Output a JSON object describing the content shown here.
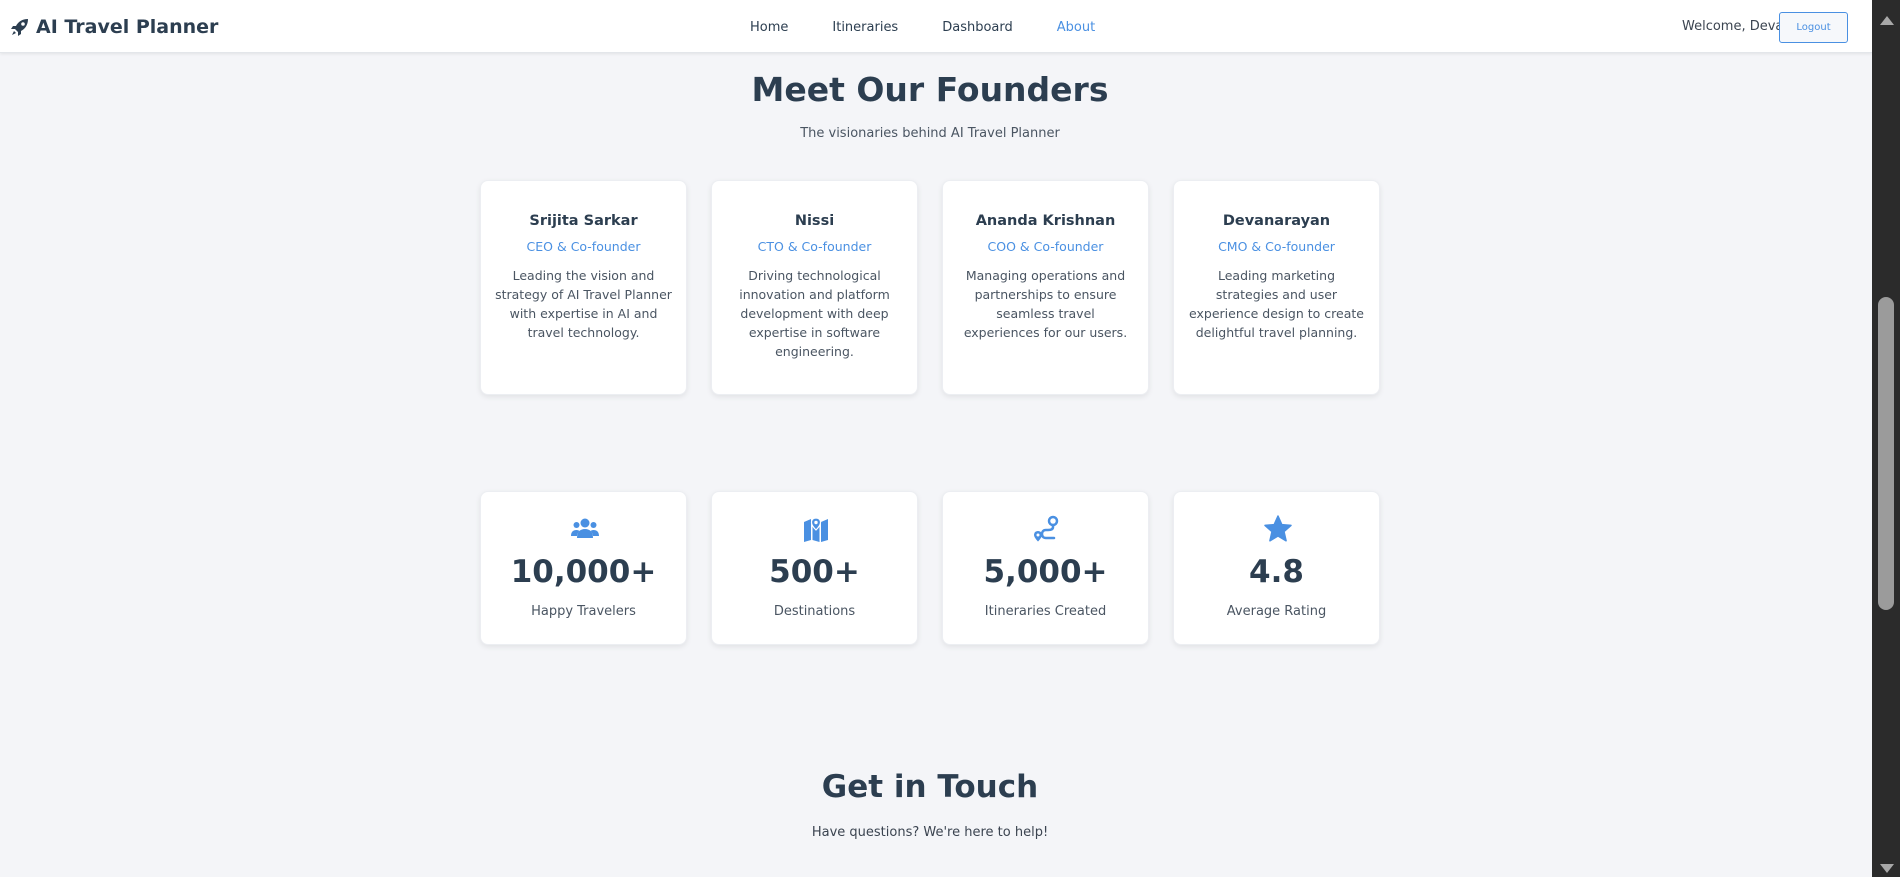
{
  "header": {
    "brand": "AI Travel Planner",
    "nav": [
      {
        "label": "Home",
        "active": false
      },
      {
        "label": "Itineraries",
        "active": false
      },
      {
        "label": "Dashboard",
        "active": false
      },
      {
        "label": "About",
        "active": true
      }
    ],
    "welcome": "Welcome, Deva",
    "logout_label": "Logout"
  },
  "founders": {
    "title": "Meet Our Founders",
    "subtitle": "The visionaries behind AI Travel Planner",
    "people": [
      {
        "name": "Srijita Sarkar",
        "role": "CEO & Co-founder",
        "description": "Leading the vision and strategy of AI Travel Planner with expertise in AI and travel technology."
      },
      {
        "name": "Nissi",
        "role": "CTO & Co-founder",
        "description": "Driving technological innovation and platform development with deep expertise in software engineering."
      },
      {
        "name": "Ananda Krishnan",
        "role": "COO & Co-founder",
        "description": "Managing operations and partnerships to ensure seamless travel experiences for our users."
      },
      {
        "name": "Devanarayan",
        "role": "CMO & Co-founder",
        "description": "Leading marketing strategies and user experience design to create delightful travel planning."
      }
    ]
  },
  "stats": [
    {
      "icon": "users-icon",
      "value": "10,000+",
      "label": "Happy Travelers"
    },
    {
      "icon": "map-icon",
      "value": "500+",
      "label": "Destinations"
    },
    {
      "icon": "route-icon",
      "value": "5,000+",
      "label": "Itineraries Created"
    },
    {
      "icon": "star-icon",
      "value": "4.8",
      "label": "Average Rating"
    }
  ],
  "contact": {
    "title": "Get in Touch",
    "subtitle": "Have questions? We're here to help!"
  },
  "colors": {
    "accent": "#4a90e2",
    "text": "#2c3e50",
    "background": "#f4f5f8"
  }
}
